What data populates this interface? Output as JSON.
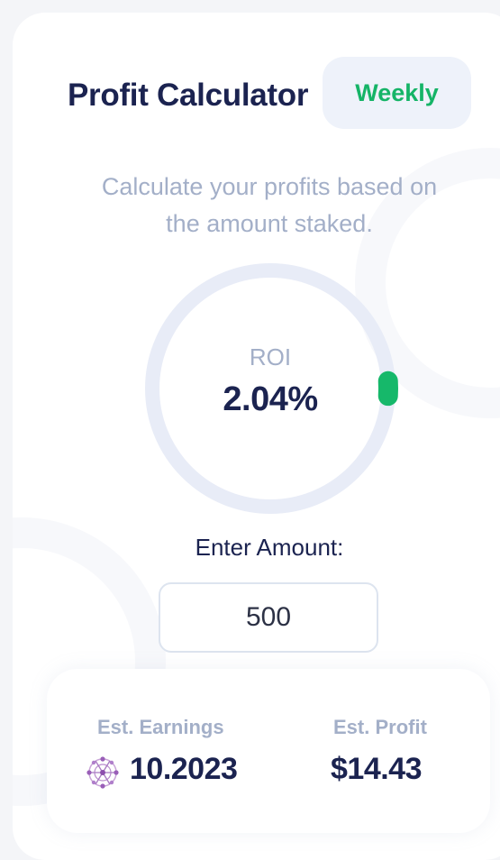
{
  "calculator": {
    "title": "Profit Calculator",
    "period": "Weekly",
    "description": "Calculate your profits based on the amount staked."
  },
  "roi": {
    "label": "ROI",
    "value": "2.04%",
    "gauge_fraction": 0.02,
    "track_color": "#e8ecf7",
    "progress_color": "#16b86a"
  },
  "amount": {
    "label": "Enter Amount:",
    "value": "500"
  },
  "estimates": {
    "earnings_label": "Est. Earnings",
    "earnings_value": "10.2023",
    "earnings_icon": "token-network-icon",
    "profit_label": "Est. Profit",
    "profit_value": "$14.43"
  },
  "colors": {
    "heading": "#1b2350",
    "muted": "#a3afc8",
    "accent_green": "#15b467",
    "button_bg": "#eef2fa"
  }
}
